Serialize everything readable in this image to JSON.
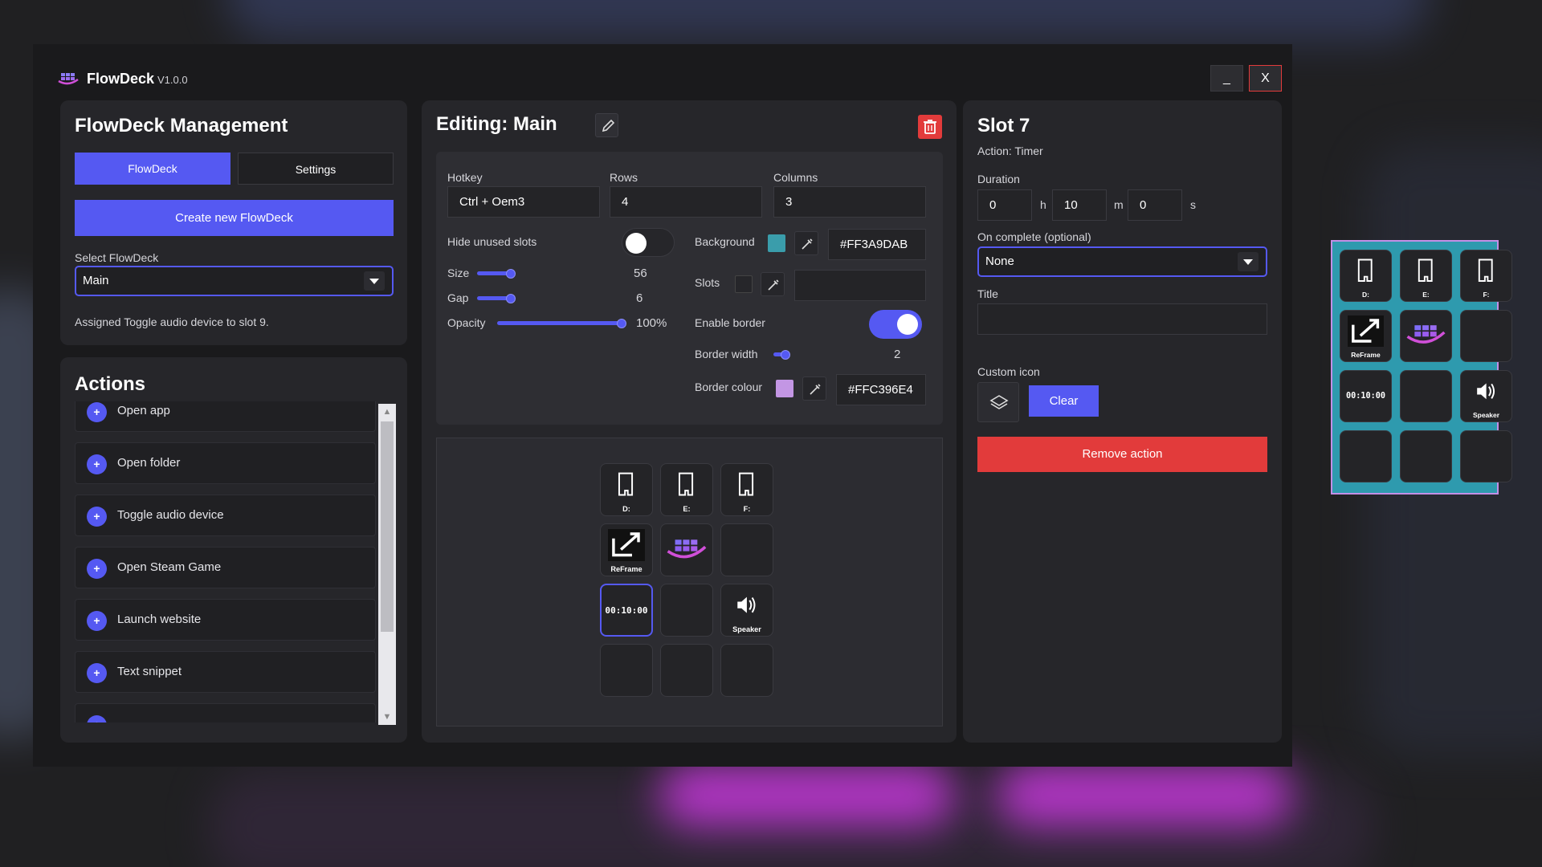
{
  "app": {
    "title": "FlowDeck",
    "version": "V1.0.0",
    "minimize_label": "_",
    "close_label": "X"
  },
  "colors": {
    "accent": "#5559f2",
    "danger": "#e23b3b",
    "deck_background": "#FF3A9DAB",
    "deck_border": "#FFC396E4"
  },
  "management": {
    "title": "FlowDeck Management",
    "tabs": [
      {
        "label": "FlowDeck",
        "active": true
      },
      {
        "label": "Settings",
        "active": false
      }
    ],
    "create_button": "Create new FlowDeck",
    "select_label": "Select FlowDeck",
    "select_value": "Main",
    "status": "Assigned Toggle audio device to slot 9."
  },
  "actions": {
    "title": "Actions",
    "add_icon": "+",
    "scroll_up": "▲",
    "scroll_down": "▼",
    "items": [
      {
        "label": "Open app"
      },
      {
        "label": "Open folder"
      },
      {
        "label": "Toggle audio device"
      },
      {
        "label": "Open Steam Game"
      },
      {
        "label": "Launch website"
      },
      {
        "label": "Text snippet"
      },
      {
        "label": ""
      }
    ]
  },
  "editing": {
    "title_prefix": "Editing:",
    "deck_name": "Main",
    "hotkey_label": "Hotkey",
    "hotkey_value": "Ctrl + Oem3",
    "rows_label": "Rows",
    "rows_value": "4",
    "columns_label": "Columns",
    "columns_value": "3",
    "hide_unused_label": "Hide unused slots",
    "hide_unused": false,
    "size_label": "Size",
    "size_value": "56",
    "size_fraction": 0.35,
    "gap_label": "Gap",
    "gap_value": "6",
    "gap_fraction": 0.35,
    "opacity_label": "Opacity",
    "opacity_value": "100%",
    "opacity_fraction": 1.0,
    "background_label": "Background",
    "background_value": "#FF3A9DAB",
    "slots_label": "Slots",
    "slots_value": "",
    "enable_border_label": "Enable border",
    "enable_border": true,
    "border_width_label": "Border width",
    "border_width_value": "2",
    "border_width_fraction": 0.5,
    "border_colour_label": "Border colour",
    "border_colour_value": "#FFC396E4"
  },
  "deck_slots": [
    {
      "kind": "drive",
      "label": "D:"
    },
    {
      "kind": "drive",
      "label": "E:"
    },
    {
      "kind": "drive",
      "label": "F:"
    },
    {
      "kind": "reframe",
      "label": "ReFrame"
    },
    {
      "kind": "flowdeck",
      "label": ""
    },
    {
      "kind": "empty",
      "label": ""
    },
    {
      "kind": "timer",
      "label": "00:10:00",
      "selected": true
    },
    {
      "kind": "empty",
      "label": ""
    },
    {
      "kind": "speaker",
      "label": "Speaker"
    },
    {
      "kind": "empty",
      "label": ""
    },
    {
      "kind": "empty",
      "label": ""
    },
    {
      "kind": "empty",
      "label": ""
    }
  ],
  "slot": {
    "title": "Slot 7",
    "action_text": "Action: Timer",
    "duration_label": "Duration",
    "hours": "0",
    "hours_unit": "h",
    "minutes": "10",
    "minutes_unit": "m",
    "seconds": "0",
    "seconds_unit": "s",
    "on_complete_label": "On complete (optional)",
    "on_complete_value": "None",
    "title_label": "Title",
    "title_value": "",
    "custom_icon_label": "Custom icon",
    "clear_button": "Clear",
    "remove_button": "Remove action"
  }
}
